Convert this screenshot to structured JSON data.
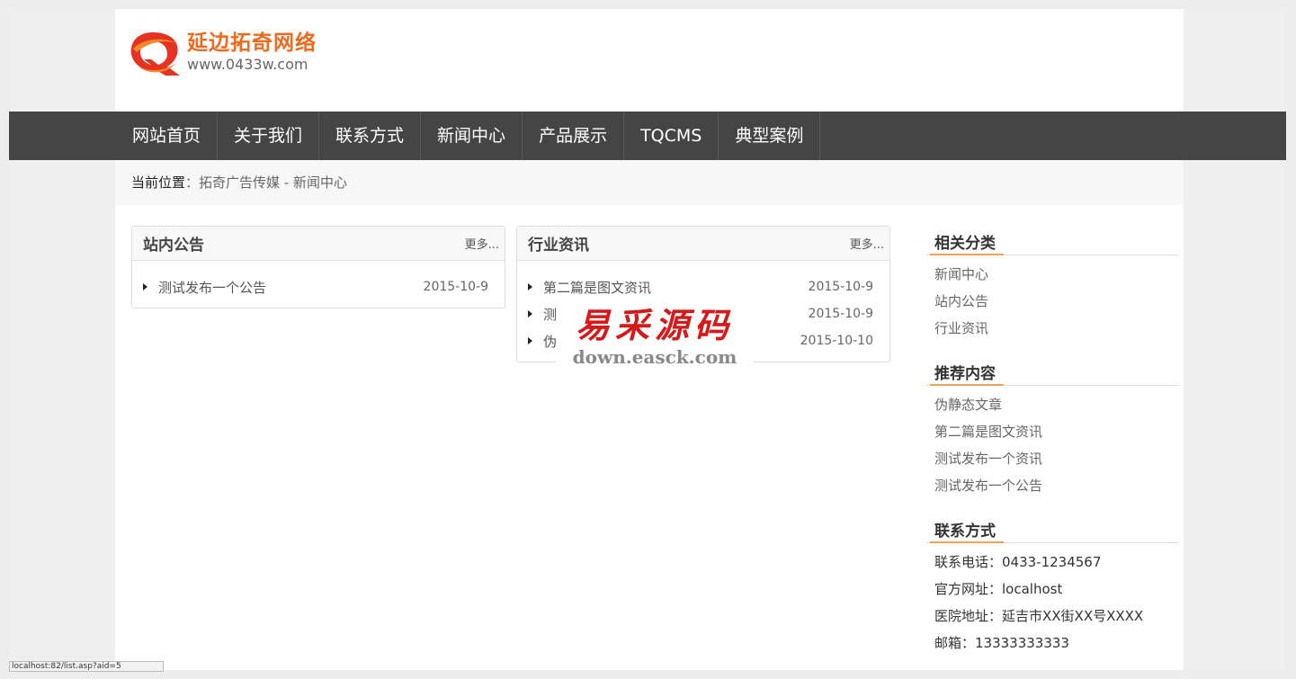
{
  "logo": {
    "title": "延边拓奇网络",
    "url": "www.0433w.com"
  },
  "nav": [
    {
      "label": "网站首页"
    },
    {
      "label": "关于我们"
    },
    {
      "label": "联系方式"
    },
    {
      "label": "新闻中心"
    },
    {
      "label": "产品展示"
    },
    {
      "label": "TQCMS"
    },
    {
      "label": "典型案例"
    }
  ],
  "breadcrumb": {
    "label": "当前位置",
    "sep": "：",
    "path": "拓奇广告传媒 - 新闻中心"
  },
  "notice_panel": {
    "title": "站内公告",
    "more": "更多...",
    "items": [
      {
        "title": "测试发布一个公告",
        "date": "2015-10-9"
      }
    ]
  },
  "industry_panel": {
    "title": "行业资讯",
    "more": "更多...",
    "items": [
      {
        "title": "第二篇是图文资讯",
        "date": "2015-10-9"
      },
      {
        "title": "测",
        "date": "2015-10-9"
      },
      {
        "title": "伪",
        "date": "2015-10-10"
      }
    ]
  },
  "watermark": {
    "cn": "易采源码",
    "url": "down.easck.com"
  },
  "sidebar": {
    "categories": {
      "title": "相关分类",
      "items": [
        "新闻中心",
        "站内公告",
        "行业资讯"
      ]
    },
    "recommended": {
      "title": "推荐内容",
      "items": [
        "伪静态文章",
        "第二篇是图文资讯",
        "测试发布一个资讯",
        "测试发布一个公告"
      ]
    },
    "contact": {
      "title": "联系方式",
      "items": [
        "联系电话：0433-1234567",
        "官方网址：localhost",
        "医院地址：延吉市XX街XX号XXXX",
        "邮箱：13333333333"
      ]
    }
  },
  "status_url": "localhost:82/list.asp?aid=5"
}
